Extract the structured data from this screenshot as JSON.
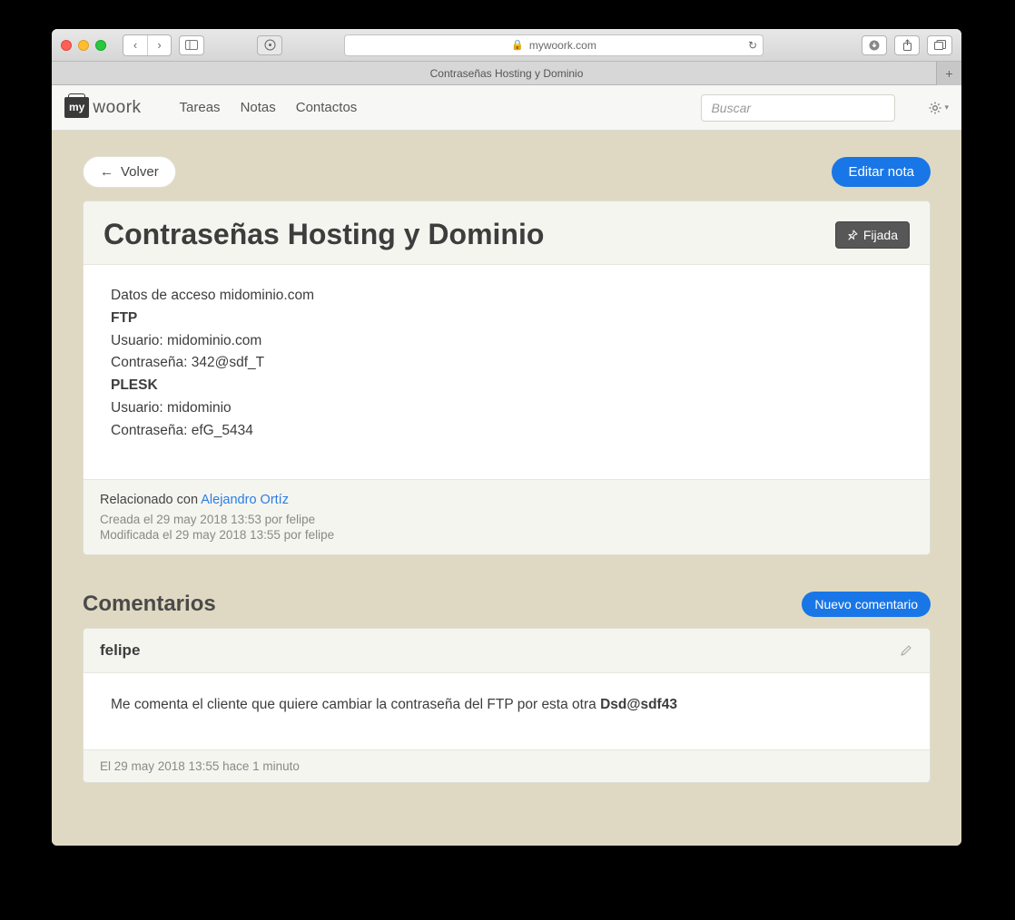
{
  "browser": {
    "url_host": "mywoork.com",
    "tab_title": "Contraseñas Hosting y Dominio"
  },
  "navbar": {
    "logo_badge": "my",
    "logo_text": "woork",
    "links": [
      "Tareas",
      "Notas",
      "Contactos"
    ],
    "search_placeholder": "Buscar"
  },
  "page": {
    "back_label": "Volver",
    "edit_label": "Editar nota",
    "title": "Contraseñas Hosting y Dominio",
    "pin_label": "Fijada",
    "body": {
      "intro": "Datos de acceso midominio.com",
      "section1_title": "FTP",
      "section1_user": "Usuario: midominio.com",
      "section1_pass": "Contraseña: 342@sdf_T",
      "section2_title": "PLESK",
      "section2_user": "Usuario: midominio",
      "section2_pass": "Contraseña: efG_5434"
    },
    "footer": {
      "related_prefix": "Relacionado con ",
      "related_link": "Alejandro Ortíz",
      "created": "Creada el 29 may 2018 13:53 por felipe",
      "modified": "Modificada el 29 may 2018 13:55 por felipe"
    }
  },
  "comments": {
    "heading": "Comentarios",
    "new_label": "Nuevo comentario",
    "items": [
      {
        "author": "felipe",
        "body_prefix": "Me comenta el cliente que quiere cambiar la contraseña del FTP por esta otra ",
        "body_strong": "Dsd@sdf43",
        "timestamp": "El 29 may 2018 13:55 hace 1 minuto"
      }
    ]
  }
}
